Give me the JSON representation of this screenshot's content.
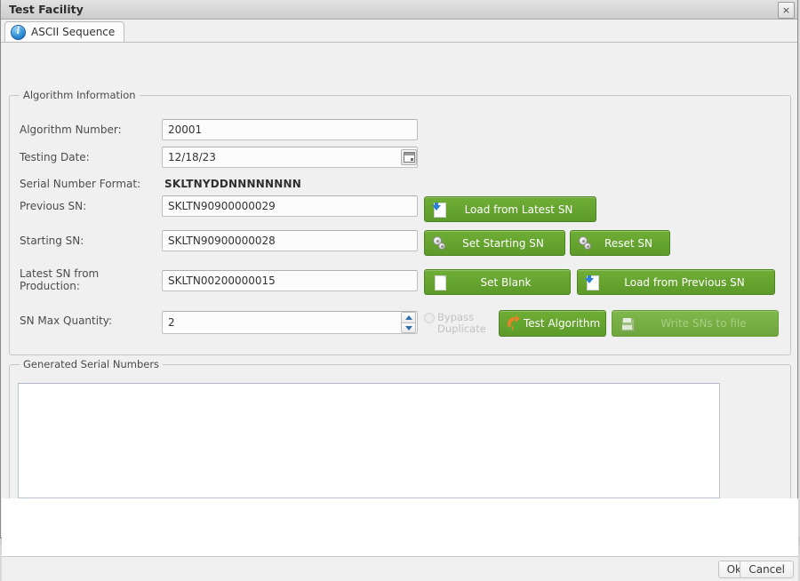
{
  "window": {
    "title": "Test Facility",
    "close_label": "×"
  },
  "tabs": [
    {
      "label": "ASCII Sequence",
      "icon": "info-icon",
      "active": true
    }
  ],
  "algorithm_group": {
    "legend": "Algorithm Information",
    "fields": {
      "algorithm_number": {
        "label": "Algorithm Number:",
        "value": "20001",
        "placeholder": ""
      },
      "testing_date": {
        "label": "Testing Date:",
        "value": "12/18/23",
        "placeholder": "",
        "picker_icon": "calendar-icon"
      },
      "serial_number_format": {
        "label": "Serial Number Format:",
        "value": "SKLTNYDDNNNNNNNN"
      },
      "previous_sn": {
        "label": "Previous SN:",
        "value": "SKLTN90900000029",
        "placeholder": ""
      },
      "starting_sn": {
        "label": "Starting SN:",
        "value": "SKLTN90900000028",
        "placeholder": ""
      },
      "latest_sn_from_production": {
        "label": "Latest SN from Production:",
        "value": "SKLTN00200000015",
        "placeholder": ""
      },
      "sn_max_quantity": {
        "label": "SN Max Quantity:",
        "value": "2",
        "placeholder": ""
      }
    },
    "buttons": {
      "load_from_latest_sn": {
        "label": "Load from Latest SN",
        "icon": "import-icon",
        "enabled": true
      },
      "set_starting_sn": {
        "label": "Set Starting SN",
        "icon": "gears-icon",
        "enabled": true
      },
      "reset_sn": {
        "label": "Reset SN",
        "icon": "gears-icon",
        "enabled": true
      },
      "set_blank": {
        "label": "Set Blank",
        "icon": "blank-page-icon",
        "enabled": true
      },
      "load_from_previous_sn": {
        "label": "Load from Previous SN",
        "icon": "import-icon",
        "enabled": true
      },
      "test_algorithm": {
        "label": "Test Algorithm",
        "icon": "refresh-icon",
        "enabled": true
      },
      "write_sns_to_file": {
        "label": "Write SNs to file",
        "icon": "save-floppy-icon",
        "enabled": false
      }
    },
    "bypass_duplicate": {
      "label_line1": "Bypass",
      "label_line2": "Duplicate",
      "checked": false,
      "enabled": false
    }
  },
  "generated_group": {
    "legend": "Generated Serial Numbers",
    "textarea_value": "",
    "textarea_placeholder": ""
  },
  "footer": {
    "ok_label": "Ok",
    "cancel_label": "Cancel"
  },
  "background_window": {
    "left_text": "—— ——————  —————  ————",
    "right_text": "—— ———"
  },
  "colors": {
    "accent_green": "#6fae35",
    "green_border": "#4d8423",
    "dialog_bg": "#f0f0f0",
    "titlebar_bg": "#d5d5d5",
    "info_blue": "#2e90d8",
    "disabled_text": "#a7cf84"
  }
}
